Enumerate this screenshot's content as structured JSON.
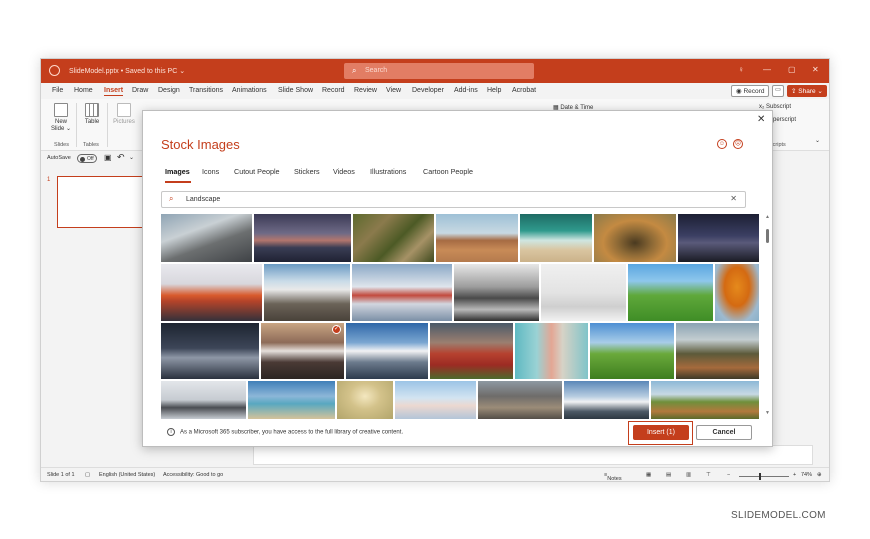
{
  "window": {
    "doc_title": "SlideModel.pptx • Saved to this PC ⌄",
    "search_placeholder": "Search"
  },
  "menu": {
    "tabs": [
      "File",
      "Home",
      "Insert",
      "Draw",
      "Design",
      "Transitions",
      "Animations",
      "Slide Show",
      "Record",
      "Review",
      "View",
      "Developer",
      "Add-ins",
      "Help",
      "Acrobat"
    ],
    "active": "Insert",
    "record_label": "Record",
    "share_label": "Share ⌄"
  },
  "ribbon": {
    "new_slide": "New Slide ⌄",
    "table": "Table",
    "pictures": "Pictures",
    "slides_group": "Slides",
    "tables_group": "Tables",
    "date_time": "Date & Time",
    "subscript": "x₂ Subscript",
    "superscript": "x² Superscript",
    "scripts_group": "Scripts"
  },
  "qat": {
    "autosave": "AutoSave",
    "autosave_state": "Off"
  },
  "slides": {
    "first_number": "1"
  },
  "statusbar": {
    "slide_info": "Slide 1 of 1",
    "language": "English (United States)",
    "accessibility": "Accessibility: Good to go",
    "notes": "Notes",
    "zoom": "74%"
  },
  "dialog": {
    "title": "Stock Images",
    "tabs": [
      "Images",
      "Icons",
      "Cutout People",
      "Stickers",
      "Videos",
      "Illustrations",
      "Cartoon People"
    ],
    "active_tab": "Images",
    "search_value": "Landscape",
    "info_text": "As a Microsoft 365 subscriber, you have access to the full library of creative content.",
    "insert_label": "Insert (1)",
    "cancel_label": "Cancel",
    "selected_count": 1
  },
  "accent_color": "#c43e1c",
  "watermark": "SLIDEMODEL.COM"
}
